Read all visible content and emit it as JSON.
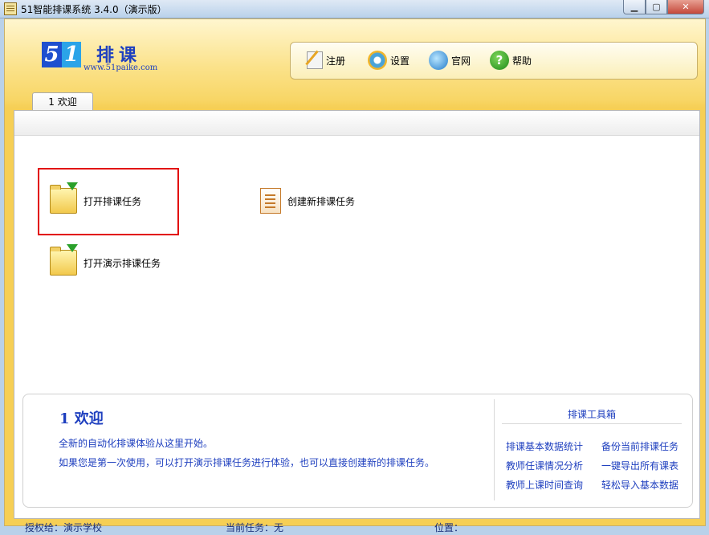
{
  "window": {
    "title": "51智能排课系统 3.4.0（演示版）"
  },
  "logo": {
    "digit5": "5",
    "digit1": "1",
    "name": "排课",
    "url": "www.51paike.com"
  },
  "toolbar": {
    "items": [
      {
        "label": "注册",
        "icon": "register-icon"
      },
      {
        "label": "设置",
        "icon": "settings-gear-icon"
      },
      {
        "label": "官网",
        "icon": "website-globe-icon"
      },
      {
        "label": "帮助",
        "icon": "help-icon"
      }
    ],
    "help_glyph": "?"
  },
  "tabs": [
    {
      "label": "1 欢迎"
    }
  ],
  "actions": {
    "open_task": "打开排课任务",
    "create_task": "创建新排课任务",
    "open_demo": "打开演示排课任务"
  },
  "welcome": {
    "title": "1  欢迎",
    "line1": "全新的自动化排课体验从这里开始。",
    "line2": "如果您是第一次使用，可以打开演示排课任务进行体验，也可以直接创建新的排课任务。"
  },
  "tools": {
    "title": "排课工具箱",
    "links": [
      "排课基本数据统计",
      "备份当前排课任务",
      "教师任课情况分析",
      "一键导出所有课表",
      "教师上课时间查询",
      "轻松导入基本数据"
    ]
  },
  "status": {
    "licensed": "授权给：演示学校",
    "current_task": "当前任务：无",
    "location": "位置："
  },
  "colors": {
    "accent_blue": "#1e3fbf",
    "highlight_red": "#e20000",
    "frame_yellow": "#f6cf55"
  }
}
